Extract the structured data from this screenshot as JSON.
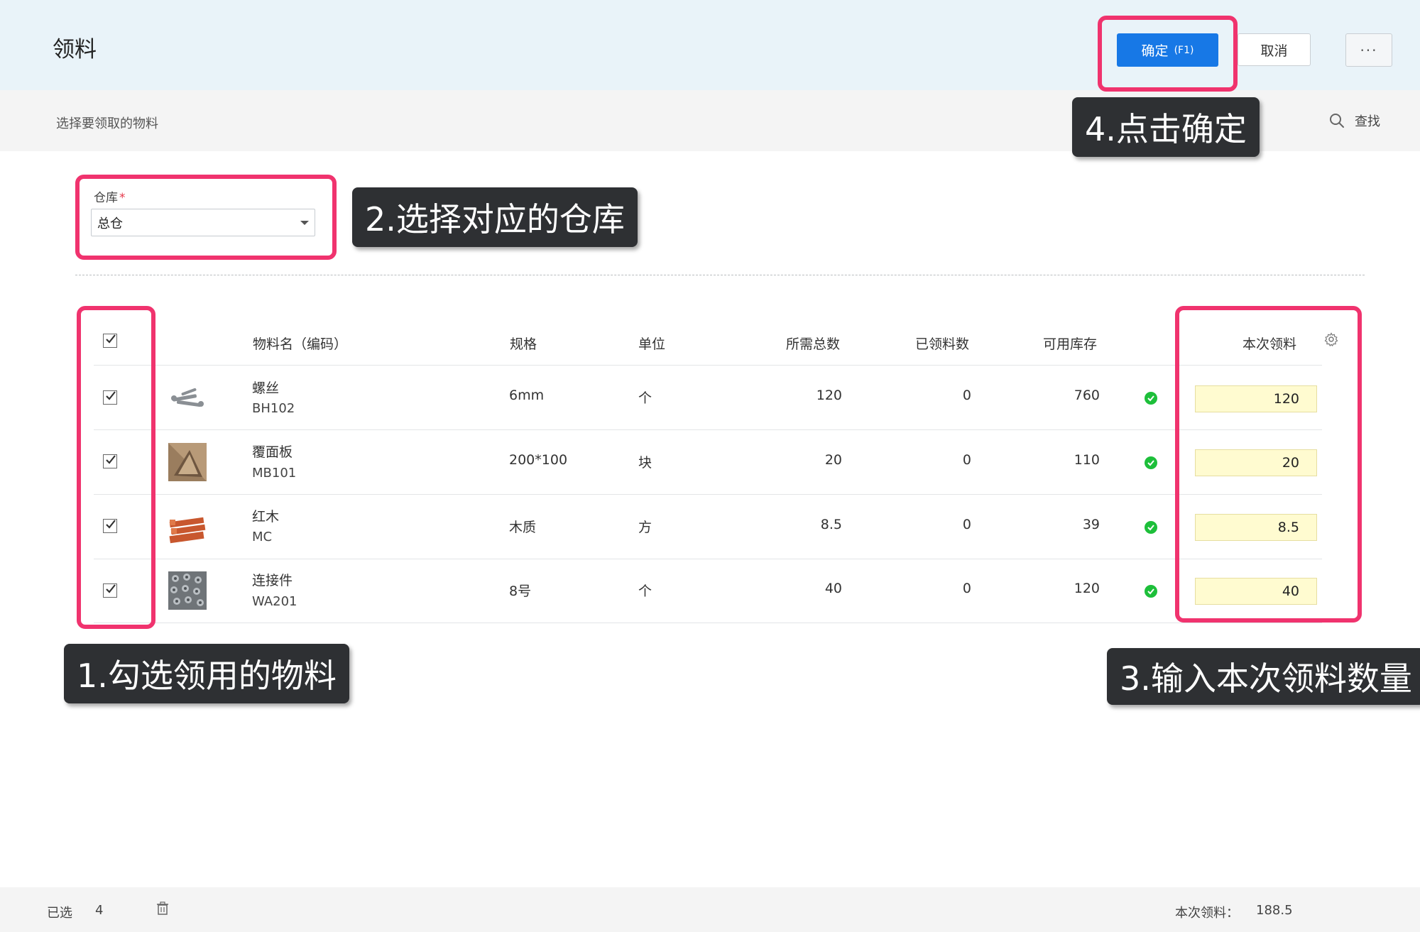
{
  "header": {
    "title": "领料",
    "ok_label": "确定",
    "ok_hotkey": "(F1)",
    "cancel_label": "取消",
    "more_label": "···"
  },
  "subbar": {
    "subtitle": "选择要领取的物料",
    "search_label": "查找"
  },
  "warehouse": {
    "label": "仓库",
    "required_mark": "*",
    "value": "总仓"
  },
  "table": {
    "columns": {
      "name": "物料名（编码）",
      "spec": "规格",
      "unit": "单位",
      "required": "所需总数",
      "received": "已领料数",
      "available": "可用库存",
      "this_time": "本次领料"
    },
    "rows": [
      {
        "name": "螺丝",
        "code": "BH102",
        "spec": "6mm",
        "unit": "个",
        "required": "120",
        "received": "0",
        "available": "760",
        "qty": "120",
        "checked": true
      },
      {
        "name": "覆面板",
        "code": "MB101",
        "spec": "200*100",
        "unit": "块",
        "required": "20",
        "received": "0",
        "available": "110",
        "qty": "20",
        "checked": true
      },
      {
        "name": "红木",
        "code": "MC",
        "spec": "木质",
        "unit": "方",
        "required": "8.5",
        "received": "0",
        "available": "39",
        "qty": "8.5",
        "checked": true
      },
      {
        "name": "连接件",
        "code": "WA201",
        "spec": "8号",
        "unit": "个",
        "required": "40",
        "received": "0",
        "available": "120",
        "qty": "40",
        "checked": true
      }
    ]
  },
  "callouts": {
    "step1": "1.勾选领用的物料",
    "step2": "2.选择对应的仓库",
    "step3": "3.输入本次领料数量",
    "step4": "4.点击确定"
  },
  "footer": {
    "selected_label": "已选",
    "selected_count": "4",
    "total_label": "本次领料：",
    "total_value": "188.5"
  },
  "colors": {
    "header_bg": "#e9f3f9",
    "primary": "#1778e6",
    "highlight": "#f0336e",
    "qty_bg": "#fffbd0",
    "ok_green": "#1dbf3a"
  },
  "icons": [
    "search-icon",
    "caret-down-icon",
    "gear-icon",
    "check-icon",
    "trash-icon",
    "more-icon"
  ]
}
